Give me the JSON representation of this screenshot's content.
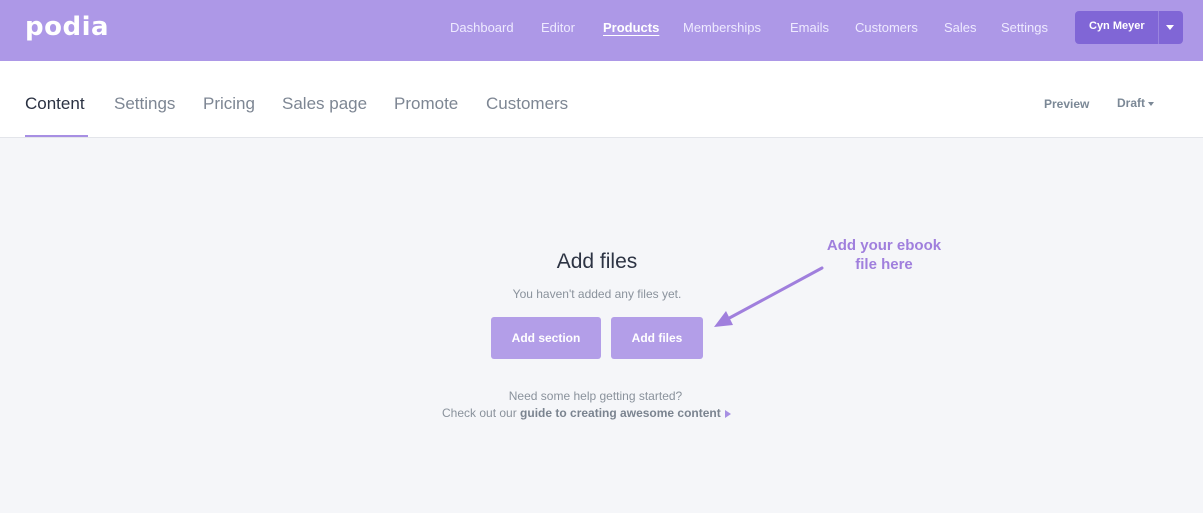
{
  "header": {
    "logo": "podia",
    "nav": [
      {
        "label": "Dashboard",
        "active": false
      },
      {
        "label": "Editor",
        "active": false
      },
      {
        "label": "Products",
        "active": true
      },
      {
        "label": "Memberships",
        "active": false
      },
      {
        "label": "Emails",
        "active": false
      },
      {
        "label": "Customers",
        "active": false
      },
      {
        "label": "Sales",
        "active": false
      },
      {
        "label": "Settings",
        "active": false
      }
    ],
    "user_name": "Cyn Meyer"
  },
  "product_nav": {
    "tabs": [
      {
        "label": "Content",
        "active": true
      },
      {
        "label": "Settings",
        "active": false
      },
      {
        "label": "Pricing",
        "active": false
      },
      {
        "label": "Sales page",
        "active": false
      },
      {
        "label": "Promote",
        "active": false
      },
      {
        "label": "Customers",
        "active": false
      }
    ],
    "preview_label": "Preview",
    "status_label": "Draft"
  },
  "main": {
    "title": "Add files",
    "subtitle": "You haven't added any files yet.",
    "add_section_label": "Add section",
    "add_files_label": "Add files",
    "help_line1": "Need some help getting started?",
    "help_line2_prefix": "Check out our ",
    "help_link": "guide to creating awesome content"
  },
  "annotation": {
    "line1": "Add your ebook",
    "line2": "file here"
  },
  "colors": {
    "header_bg": "#ad98e7",
    "accent": "#8066d6",
    "button": "#b39ee8",
    "annotation": "#a07fdd"
  }
}
